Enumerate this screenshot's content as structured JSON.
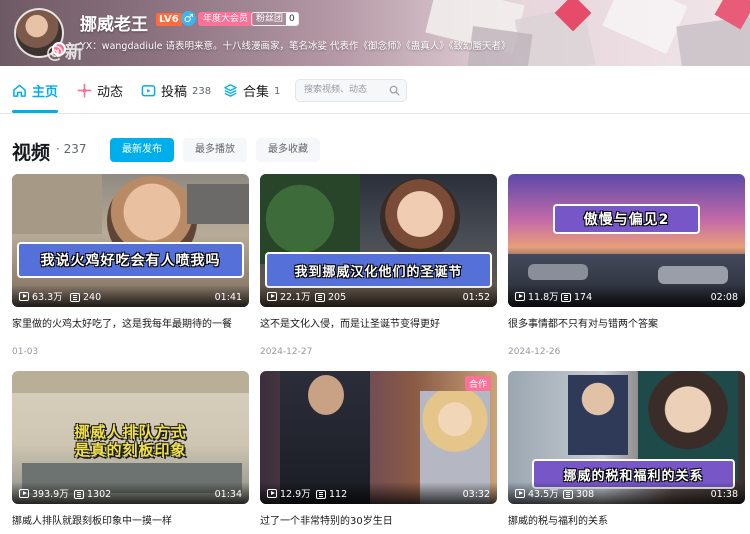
{
  "header": {
    "username": "挪威老王",
    "level": "LV6",
    "gender_symbol": "♂",
    "vip_label": "年度大会员",
    "fans_label": "粉丝团",
    "fans_count": "0",
    "signature": "YX：wangdadiule 请表明来意。十八线漫画家，笔名冰娑 代表作《御念师》《蛊真人》《致幻蜃天者》",
    "watermark": "@新"
  },
  "nav": {
    "tabs": [
      {
        "label": "主页",
        "count": ""
      },
      {
        "label": "动态",
        "count": ""
      },
      {
        "label": "投稿",
        "count": "238"
      },
      {
        "label": "合集",
        "count": "1"
      }
    ],
    "search_placeholder": "搜索视频、动态"
  },
  "section": {
    "title": "视频",
    "count": "· 237",
    "sort_options": [
      "最新发布",
      "最多播放",
      "最多收藏"
    ]
  },
  "videos": [
    {
      "caption": "我说火鸡好吃会有人喷我吗",
      "views": "63.3万",
      "danmaku": "240",
      "duration": "01:41",
      "title": "家里做的火鸡太好吃了，这是我每年最期待的一餐",
      "date": "01-03",
      "badge": ""
    },
    {
      "caption": "我到挪威汉化他们的圣诞节",
      "views": "22.1万",
      "danmaku": "205",
      "duration": "01:52",
      "title": "这不是文化入侵，而是让圣诞节变得更好",
      "date": "2024-12-27",
      "badge": ""
    },
    {
      "caption": "傲慢与偏见2",
      "views": "11.8万",
      "danmaku": "174",
      "duration": "02:08",
      "title": "很多事情都不只有对与错两个答案",
      "date": "2024-12-26",
      "badge": ""
    },
    {
      "caption_line1": "挪威人排队方式",
      "caption_line2": "是真的刻板印象",
      "views": "393.9万",
      "danmaku": "1302",
      "duration": "01:34",
      "title": "挪威人排队就跟刻板印象中一摸一样",
      "date": "",
      "badge": ""
    },
    {
      "caption": "",
      "views": "12.9万",
      "danmaku": "112",
      "duration": "03:32",
      "title": "过了一个非常特别的30岁生日",
      "date": "",
      "badge": "合作"
    },
    {
      "caption": "挪威的税和福利的关系",
      "views": "43.5万",
      "danmaku": "308",
      "duration": "01:38",
      "title": "挪威的税与福利的关系",
      "date": "",
      "badge": ""
    }
  ],
  "colors": {
    "accent": "#00aeec",
    "pink": "#fb7299"
  }
}
